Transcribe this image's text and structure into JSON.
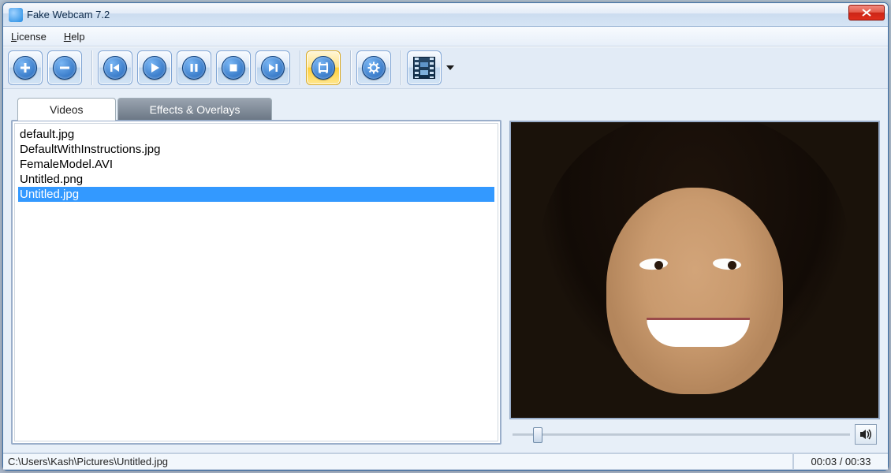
{
  "window": {
    "title": "Fake Webcam 7.2"
  },
  "menu": {
    "license": "License",
    "help": "Help"
  },
  "tabs": {
    "videos": "Videos",
    "effects": "Effects & Overlays",
    "active": "Videos"
  },
  "files": [
    {
      "name": "default.jpg",
      "selected": false
    },
    {
      "name": "DefaultWithInstructions.jpg",
      "selected": false
    },
    {
      "name": "FemaleModel.AVI",
      "selected": false
    },
    {
      "name": "Untitled.png",
      "selected": false
    },
    {
      "name": "Untitled.jpg",
      "selected": true
    }
  ],
  "status": {
    "path": "C:\\Users\\Kash\\Pictures\\Untitled.jpg",
    "time": "00:03 / 00:33"
  },
  "toolbar": {
    "add": "add",
    "remove": "remove",
    "prev": "previous",
    "play": "play",
    "pause": "pause",
    "stop": "stop",
    "next": "next",
    "fitscreen": "fit",
    "settings": "settings",
    "mediatype": "media-type"
  },
  "icons": {
    "close": "close",
    "volume": "volume"
  }
}
